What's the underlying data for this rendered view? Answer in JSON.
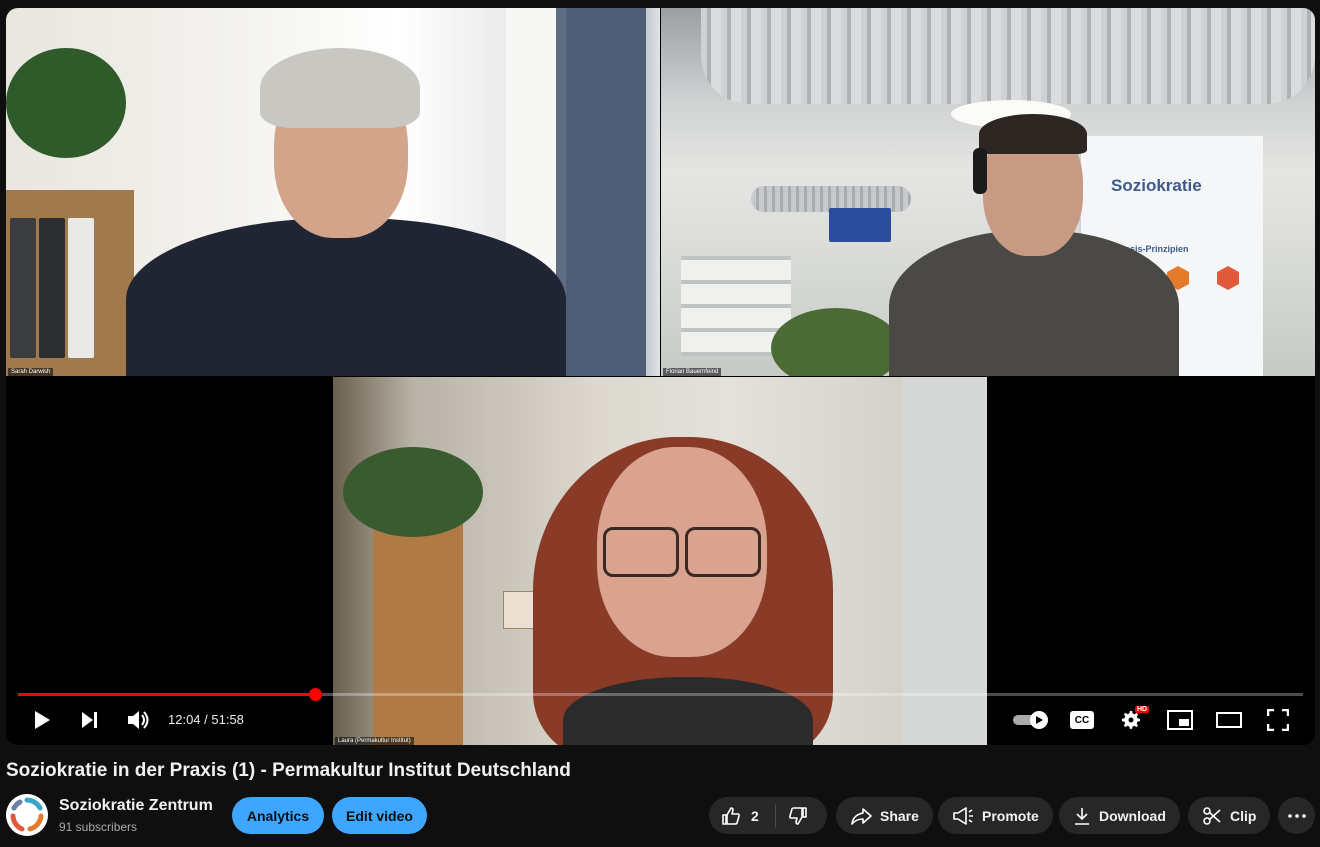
{
  "video": {
    "participants": [
      {
        "name": "Sarah Darwish"
      },
      {
        "name": "Florian Bauernfeind"
      },
      {
        "name": "Laura (Permakultur Institut)"
      }
    ],
    "banner": {
      "title": "Soziokratie",
      "subtitle": "4 Basis-Prinzipien"
    },
    "progress": 0.2313,
    "time_current": "12:04",
    "time_total": "51:58",
    "time_display": "12:04 / 51:58",
    "icons": {
      "play": "play-icon",
      "next": "next-icon",
      "volume": "volume-icon",
      "autoplay": "autoplay-toggle-icon",
      "captions": "cc-icon",
      "settings": "gear-icon",
      "miniplayer": "miniplayer-icon",
      "theater": "theater-icon",
      "fullscreen": "fullscreen-icon"
    },
    "settings_badge": "HD",
    "captions_label": "CC",
    "accent": "#ff0000"
  },
  "title": "Soziokratie in der Praxis (1) - Permakultur Institut Deutschland",
  "channel": {
    "name": "Soziokratie Zentrum",
    "subscribers": "91 subscribers"
  },
  "actions": {
    "analytics": "Analytics",
    "edit_video": "Edit video",
    "like_count": "2",
    "share": "Share",
    "promote": "Promote",
    "download": "Download",
    "clip": "Clip"
  }
}
